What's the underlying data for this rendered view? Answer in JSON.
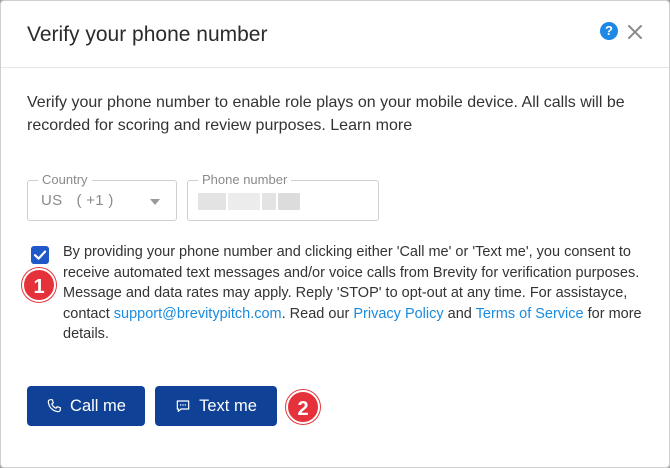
{
  "dialog": {
    "title": "Verify your phone number",
    "help_icon_glyph": "?",
    "description": "Verify your phone number to enable role plays on your mobile device. All calls will be recorded for scoring and review purposes. Learn more"
  },
  "form": {
    "country_label": "Country",
    "country_value": "US",
    "country_code": "( +1 )",
    "phone_label": "Phone number",
    "consent_checked": true,
    "consent_text_1": "By providing your phone number and clicking either 'Call me' or 'Text me', you consent to receive automated text messages and/or voice calls from Brevity for verification purposes. Message and data rates may apply. Reply 'STOP' to opt-out at any time. For assistayce, contact ",
    "support_email": "support@brevitypitch.com",
    "consent_text_2": ". Read our ",
    "privacy_link": "Privacy Policy",
    "consent_text_3": " and ",
    "terms_link": "Terms of Service",
    "consent_text_4": " for more details."
  },
  "actions": {
    "call_label": "Call me",
    "text_label": "Text me"
  },
  "annotations": {
    "marker_1": "1",
    "marker_2": "2"
  },
  "colors": {
    "primary_button": "#0f4296",
    "link": "#1a8be0",
    "help_icon": "#1e88e5",
    "marker": "#e5323a"
  }
}
